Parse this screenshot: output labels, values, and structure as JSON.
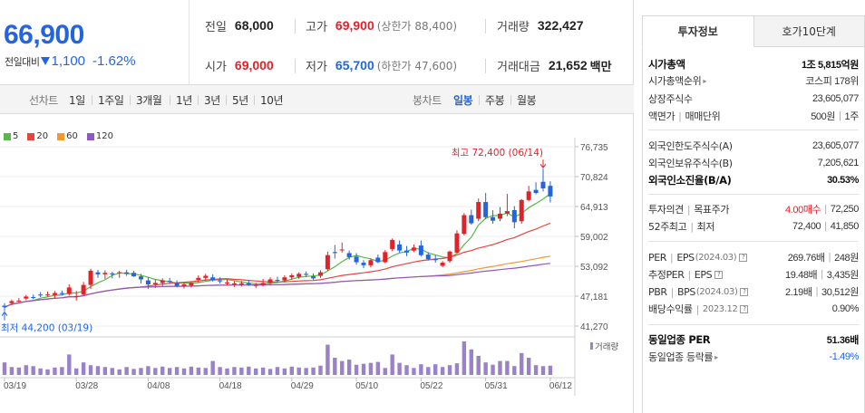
{
  "summary": {
    "price": "66,900",
    "change_label": "전일대비",
    "change_value": "1,100",
    "change_rate": "-1.62%",
    "prev_close_label": "전일",
    "prev_close": "68,000",
    "high_label": "고가",
    "high": "69,900",
    "upper_limit": "(상한가 88,400)",
    "volume_label": "거래량",
    "volume": "322,427",
    "open_label": "시가",
    "open": "69,000",
    "low_label": "저가",
    "low": "65,700",
    "lower_limit": "(하한가 47,600)",
    "amount_label": "거래대금",
    "amount": "21,652",
    "amount_unit": "백만"
  },
  "period_bar": {
    "line_chart_label": "선차트",
    "line_periods": [
      "1일",
      "1주일",
      "3개월",
      "1년",
      "3년",
      "5년",
      "10년"
    ],
    "candle_chart_label": "봉차트",
    "candle_periods": [
      "일봉",
      "주봉",
      "월봉"
    ],
    "active_candle": "일봉"
  },
  "colors": {
    "up": "#e0222a",
    "down": "#2365e0",
    "ma5": "#58b84a",
    "ma20": "#e8443e",
    "ma60": "#f29a2e",
    "ma120": "#8d57c4",
    "volume_bar": "#9a82c8"
  },
  "chart_data": {
    "type": "candlestick",
    "legend": [
      {
        "name": "5",
        "color": "#58b84a"
      },
      {
        "name": "20",
        "color": "#e8443e"
      },
      {
        "name": "60",
        "color": "#f29a2e"
      },
      {
        "name": "120",
        "color": "#8d57c4"
      }
    ],
    "y_ticks": [
      "76,735",
      "70,824",
      "64,913",
      "59,002",
      "53,092",
      "47,181",
      "41,270"
    ],
    "ylim": [
      41270,
      76735
    ],
    "x_ticks": [
      "03/19",
      "03/28",
      "04/08",
      "04/18",
      "04/29",
      "05/10",
      "05/22",
      "05/31",
      "06/12"
    ],
    "max_annotation": "최고 72,400 (06/14)",
    "min_annotation": "최저 44,200 (03/19)",
    "volume_label": "거래량",
    "candles": [
      {
        "o": 45300,
        "h": 45800,
        "l": 44200,
        "c": 45000
      },
      {
        "o": 45800,
        "h": 46500,
        "l": 45400,
        "c": 46200
      },
      {
        "o": 46200,
        "h": 46800,
        "l": 45900,
        "c": 46300
      },
      {
        "o": 46700,
        "h": 47400,
        "l": 46400,
        "c": 47100
      },
      {
        "o": 47000,
        "h": 47500,
        "l": 46600,
        "c": 46900
      },
      {
        "o": 47500,
        "h": 48000,
        "l": 47000,
        "c": 47400
      },
      {
        "o": 47500,
        "h": 48100,
        "l": 47100,
        "c": 47500
      },
      {
        "o": 47400,
        "h": 48200,
        "l": 46700,
        "c": 47800
      },
      {
        "o": 47800,
        "h": 48300,
        "l": 47300,
        "c": 47600
      },
      {
        "o": 47600,
        "h": 49500,
        "l": 47300,
        "c": 48900
      },
      {
        "o": 47000,
        "h": 48200,
        "l": 46300,
        "c": 47200
      },
      {
        "o": 47500,
        "h": 50000,
        "l": 47300,
        "c": 49400
      },
      {
        "o": 49400,
        "h": 52600,
        "l": 48600,
        "c": 52200
      },
      {
        "o": 51900,
        "h": 52400,
        "l": 50800,
        "c": 51500
      },
      {
        "o": 51500,
        "h": 52300,
        "l": 50600,
        "c": 51800
      },
      {
        "o": 51700,
        "h": 52000,
        "l": 50700,
        "c": 51500
      },
      {
        "o": 51800,
        "h": 52200,
        "l": 50800,
        "c": 51900
      },
      {
        "o": 51900,
        "h": 52400,
        "l": 51200,
        "c": 51600
      },
      {
        "o": 51800,
        "h": 52200,
        "l": 51000,
        "c": 51100
      },
      {
        "o": 51100,
        "h": 51600,
        "l": 49700,
        "c": 50500
      },
      {
        "o": 50300,
        "h": 50900,
        "l": 48600,
        "c": 49500
      },
      {
        "o": 49500,
        "h": 50500,
        "l": 48800,
        "c": 49800
      },
      {
        "o": 49800,
        "h": 50700,
        "l": 49200,
        "c": 50300
      },
      {
        "o": 50200,
        "h": 50800,
        "l": 49600,
        "c": 50000
      },
      {
        "o": 49800,
        "h": 50300,
        "l": 48900,
        "c": 49200
      },
      {
        "o": 49200,
        "h": 49800,
        "l": 48700,
        "c": 49500
      },
      {
        "o": 49300,
        "h": 50100,
        "l": 48900,
        "c": 49800
      },
      {
        "o": 50400,
        "h": 51300,
        "l": 49800,
        "c": 50800
      },
      {
        "o": 50800,
        "h": 51600,
        "l": 50200,
        "c": 51200
      },
      {
        "o": 50900,
        "h": 51500,
        "l": 50100,
        "c": 50400
      },
      {
        "o": 50300,
        "h": 50900,
        "l": 49700,
        "c": 50100
      },
      {
        "o": 49700,
        "h": 50500,
        "l": 49300,
        "c": 49900
      },
      {
        "o": 49500,
        "h": 50200,
        "l": 49000,
        "c": 49700
      },
      {
        "o": 49500,
        "h": 50200,
        "l": 49100,
        "c": 49700
      },
      {
        "o": 49700,
        "h": 50400,
        "l": 49200,
        "c": 49500
      },
      {
        "o": 49200,
        "h": 49800,
        "l": 48800,
        "c": 49400
      },
      {
        "o": 49400,
        "h": 50600,
        "l": 49100,
        "c": 49800
      },
      {
        "o": 49800,
        "h": 50900,
        "l": 49300,
        "c": 50500
      },
      {
        "o": 50400,
        "h": 51000,
        "l": 49900,
        "c": 50200
      },
      {
        "o": 50300,
        "h": 51300,
        "l": 49900,
        "c": 50900
      },
      {
        "o": 50900,
        "h": 51700,
        "l": 50400,
        "c": 51300
      },
      {
        "o": 51000,
        "h": 51900,
        "l": 50600,
        "c": 51600
      },
      {
        "o": 51600,
        "h": 52100,
        "l": 50900,
        "c": 51400
      },
      {
        "o": 51100,
        "h": 51700,
        "l": 50400,
        "c": 50700
      },
      {
        "o": 51200,
        "h": 52300,
        "l": 50800,
        "c": 51900
      },
      {
        "o": 52500,
        "h": 56000,
        "l": 52200,
        "c": 55300
      },
      {
        "o": 55900,
        "h": 57300,
        "l": 54600,
        "c": 55700
      },
      {
        "o": 56300,
        "h": 57800,
        "l": 55800,
        "c": 56400
      },
      {
        "o": 55700,
        "h": 56200,
        "l": 54400,
        "c": 54900
      },
      {
        "o": 55000,
        "h": 55700,
        "l": 53400,
        "c": 53900
      },
      {
        "o": 53800,
        "h": 54300,
        "l": 52700,
        "c": 53300
      },
      {
        "o": 53300,
        "h": 54600,
        "l": 52900,
        "c": 54300
      },
      {
        "o": 54800,
        "h": 55400,
        "l": 53700,
        "c": 53900
      },
      {
        "o": 53900,
        "h": 56300,
        "l": 53700,
        "c": 55900
      },
      {
        "o": 56500,
        "h": 58600,
        "l": 56100,
        "c": 58300
      },
      {
        "o": 57400,
        "h": 58200,
        "l": 55800,
        "c": 56200
      },
      {
        "o": 56200,
        "h": 57100,
        "l": 55100,
        "c": 55800
      },
      {
        "o": 56200,
        "h": 57400,
        "l": 55900,
        "c": 56800
      },
      {
        "o": 57200,
        "h": 58200,
        "l": 55000,
        "c": 55300
      },
      {
        "o": 55400,
        "h": 55900,
        "l": 54200,
        "c": 54500
      },
      {
        "o": 54500,
        "h": 55300,
        "l": 53800,
        "c": 54300
      },
      {
        "o": 53200,
        "h": 54100,
        "l": 52900,
        "c": 53800
      },
      {
        "o": 54100,
        "h": 56200,
        "l": 53800,
        "c": 56000
      },
      {
        "o": 55800,
        "h": 60200,
        "l": 55700,
        "c": 59600
      },
      {
        "o": 59500,
        "h": 63600,
        "l": 59200,
        "c": 63200
      },
      {
        "o": 63200,
        "h": 64300,
        "l": 61300,
        "c": 61600
      },
      {
        "o": 62500,
        "h": 66500,
        "l": 62000,
        "c": 65800
      },
      {
        "o": 65800,
        "h": 67600,
        "l": 62400,
        "c": 62800
      },
      {
        "o": 62800,
        "h": 64200,
        "l": 61500,
        "c": 62100
      },
      {
        "o": 62500,
        "h": 64800,
        "l": 62000,
        "c": 63500
      },
      {
        "o": 63500,
        "h": 67400,
        "l": 63000,
        "c": 64000
      },
      {
        "o": 64200,
        "h": 65000,
        "l": 60600,
        "c": 61800
      },
      {
        "o": 62000,
        "h": 66400,
        "l": 61500,
        "c": 66200
      },
      {
        "o": 66200,
        "h": 69000,
        "l": 65900,
        "c": 67900
      },
      {
        "o": 68200,
        "h": 69700,
        "l": 67300,
        "c": 67600
      },
      {
        "o": 69800,
        "h": 72400,
        "l": 67900,
        "c": 68500
      },
      {
        "o": 69000,
        "h": 69900,
        "l": 65700,
        "c": 66900
      }
    ],
    "volume": [
      27,
      17,
      16,
      21,
      19,
      14,
      12,
      16,
      17,
      44,
      14,
      27,
      21,
      19,
      17,
      15,
      12,
      17,
      13,
      15,
      19,
      15,
      18,
      15,
      17,
      14,
      18,
      16,
      15,
      30,
      17,
      14,
      17,
      16,
      18,
      14,
      16,
      13,
      17,
      14,
      18,
      16,
      15,
      16,
      20,
      65,
      37,
      30,
      33,
      22,
      24,
      26,
      28,
      15,
      44,
      26,
      21,
      15,
      23,
      17,
      23,
      17,
      21,
      25,
      72,
      55,
      41,
      27,
      22,
      30,
      30,
      19,
      47,
      37,
      21,
      19,
      20
    ]
  },
  "right_panel": {
    "tabs": [
      "투자정보",
      "호가10단계"
    ],
    "active_tab": "투자정보",
    "market_cap_label": "시가총액",
    "market_cap": "1조 5,815억원",
    "market_cap_rank_label": "시가총액순위",
    "market_cap_rank": "코스피 178위",
    "shares_label": "상장주식수",
    "shares": "23,605,077",
    "face_value_label": "액면가",
    "trade_unit_label": "매매단위",
    "face_value": "500원",
    "trade_unit": "1주",
    "foreign_limit_label": "외국인한도주식수(A)",
    "foreign_limit": "23,605,077",
    "foreign_hold_label": "외국인보유주식수(B)",
    "foreign_hold": "7,205,621",
    "foreign_ratio_label": "외국인소진율(B/A)",
    "foreign_ratio": "30.53%",
    "opinion_label": "투자의견",
    "target_label": "목표주가",
    "opinion": "4.00매수",
    "target": "72,250",
    "wk52_high_label": "52주최고",
    "wk52_low_label": "최저",
    "wk52_high": "72,400",
    "wk52_low": "41,850",
    "per_label": "PER",
    "eps_label": "EPS",
    "eps_period": "(2024.03)",
    "per": "269.76배",
    "eps": "248원",
    "est_per_label": "추정PER",
    "est_eps_label": "EPS",
    "est_per": "19.48배",
    "est_eps": "3,435원",
    "pbr_label": "PBR",
    "bps_label": "BPS",
    "bps_period": "(2024.03)",
    "pbr": "2.19배",
    "bps": "30,512원",
    "div_label": "배당수익률",
    "div_period": "2023.12",
    "div": "0.90%",
    "sector_per_label": "동일업종 PER",
    "sector_per": "51.36배",
    "sector_rate_label": "동일업종 등락률",
    "sector_rate": "-1.49%"
  }
}
